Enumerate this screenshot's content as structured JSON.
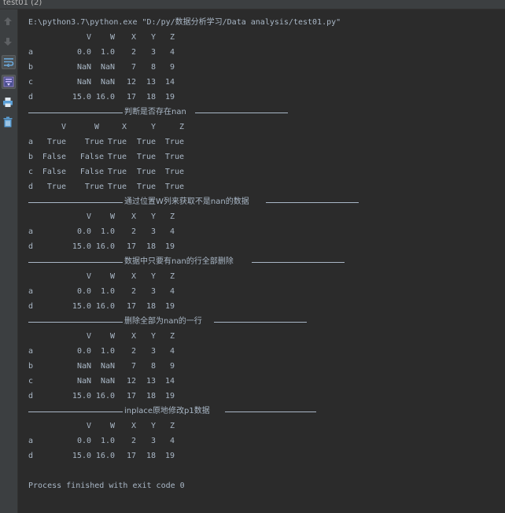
{
  "window": {
    "tab_title": "test01 (2)"
  },
  "toolbar": {
    "buttons": [
      {
        "icon": "arrow-up-icon"
      },
      {
        "icon": "arrow-down-icon"
      },
      {
        "icon": "soft-wrap-icon"
      },
      {
        "icon": "scroll-to-end-icon"
      },
      {
        "icon": "print-icon"
      },
      {
        "icon": "trash-icon"
      }
    ]
  },
  "console": {
    "command": "E:\\python3.7\\python.exe \"D:/py/数据分析学习/Data analysis/test01.py\"",
    "blocks": [
      {
        "header": [
          "V",
          "W",
          "X",
          "Y",
          "Z"
        ],
        "rows": [
          [
            "a",
            "0.0",
            "1.0",
            "2",
            "3",
            "4"
          ],
          [
            "b",
            "NaN",
            "NaN",
            "7",
            "8",
            "9"
          ],
          [
            "c",
            "NaN",
            "NaN",
            "12",
            "13",
            "14"
          ],
          [
            "d",
            "15.0",
            "16.0",
            "17",
            "18",
            "19"
          ]
        ]
      },
      {
        "separator": "判断是否存在nan",
        "header": [
          "V",
          "W",
          "X",
          "Y",
          "Z"
        ],
        "rows": [
          [
            "a",
            "True",
            "True",
            "True",
            "True",
            "True"
          ],
          [
            "b",
            "False",
            "False",
            "True",
            "True",
            "True"
          ],
          [
            "c",
            "False",
            "False",
            "True",
            "True",
            "True"
          ],
          [
            "d",
            "True",
            "True",
            "True",
            "True",
            "True"
          ]
        ]
      },
      {
        "separator": "通过位置W列来获取不是nan的数据",
        "header": [
          "V",
          "W",
          "X",
          "Y",
          "Z"
        ],
        "rows": [
          [
            "a",
            "0.0",
            "1.0",
            "2",
            "3",
            "4"
          ],
          [
            "d",
            "15.0",
            "16.0",
            "17",
            "18",
            "19"
          ]
        ]
      },
      {
        "separator": "数据中只要有nan的行全部删除",
        "header": [
          "V",
          "W",
          "X",
          "Y",
          "Z"
        ],
        "rows": [
          [
            "a",
            "0.0",
            "1.0",
            "2",
            "3",
            "4"
          ],
          [
            "d",
            "15.0",
            "16.0",
            "17",
            "18",
            "19"
          ]
        ]
      },
      {
        "separator": "删除全部为nan的一行",
        "header": [
          "V",
          "W",
          "X",
          "Y",
          "Z"
        ],
        "rows": [
          [
            "a",
            "0.0",
            "1.0",
            "2",
            "3",
            "4"
          ],
          [
            "b",
            "NaN",
            "NaN",
            "7",
            "8",
            "9"
          ],
          [
            "c",
            "NaN",
            "NaN",
            "12",
            "13",
            "14"
          ],
          [
            "d",
            "15.0",
            "16.0",
            "17",
            "18",
            "19"
          ]
        ]
      },
      {
        "separator": "inplace原地修改p1数据",
        "header": [
          "V",
          "W",
          "X",
          "Y",
          "Z"
        ],
        "rows": [
          [
            "a",
            "0.0",
            "1.0",
            "2",
            "3",
            "4"
          ],
          [
            "d",
            "15.0",
            "16.0",
            "17",
            "18",
            "19"
          ]
        ]
      }
    ],
    "exit_message": "Process finished with exit code 0"
  }
}
